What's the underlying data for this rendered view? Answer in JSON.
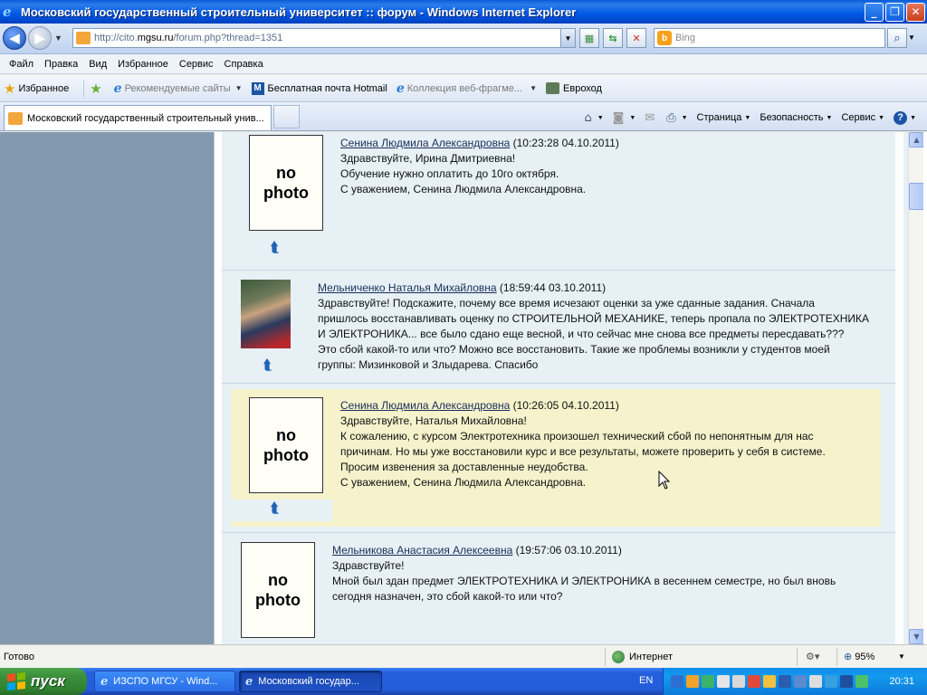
{
  "window": {
    "title": "Московский государственный строительный университет :: форум - Windows Internet Explorer",
    "buttons": {
      "minimize": "_",
      "maximize": "❐",
      "close": "✕"
    }
  },
  "address": {
    "url_prefix": "http://cito.",
    "url_domain": "mgsu.ru",
    "url_suffix": "/forum.php?thread=1351",
    "search_placeholder": "Bing"
  },
  "menu": [
    "Файл",
    "Правка",
    "Вид",
    "Избранное",
    "Сервис",
    "Справка"
  ],
  "favorites": {
    "favorites_label": "Избранное",
    "recommended": "Рекомендуемые сайты",
    "hotmail": "Бесплатная почта Hotmail",
    "webslice": "Коллекция веб-фрагме...",
    "euro": "Евроход"
  },
  "tab": {
    "label": "Московский государственный строительный унив..."
  },
  "commands": {
    "page": "Страница",
    "safety": "Безопасность",
    "tools": "Сервис"
  },
  "posts": [
    {
      "author": "Сенина Людмила Александровна",
      "time": "(10:23:28 04.10.2011)",
      "avatar": "no photo",
      "lines": [
        "Здравствуйте, Ирина Дмитриевна!",
        "Обучение нужно оплатить до 10го октября.",
        "С уважением, Сенина Людмила Александровна."
      ]
    },
    {
      "author": "Мельниченко Наталья Михайловна",
      "time": "(18:59:44 03.10.2011)",
      "avatar": "photo",
      "lines": [
        "Здравствуйте! Подскажите, почему все время исчезают оценки за уже сданные задания. Сначала",
        "пришлось восстанавливать оценку по СТРОИТЕЛЬНОЙ МЕХАНИКЕ, теперь пропала по ЭЛЕКТРОТЕХНИКА",
        "И ЭЛЕКТРОНИКА... все было сдано еще весной, и что сейчас мне снова все предметы пересдавать???",
        "Это сбой какой-то или что? Можно все восстановить. Такие же проблемы возникли у студентов моей",
        "группы: Мизинковой и Злыдарева. Спасибо"
      ]
    },
    {
      "author": "Сенина Людмила Александровна",
      "time": "(10:26:05 04.10.2011)",
      "avatar": "no photo",
      "lines": [
        "Здравствуйте, Наталья Михайловна!",
        "К сожалению, с курсом Электротехника произошел технический сбой по непонятным для нас",
        "причинам. Но мы уже восстановили курс и все результаты, можете проверить у себя в системе.",
        "Просим извенения за доставленные неудобства.",
        "С уважением, Сенина Людмила Александровна."
      ]
    },
    {
      "author": "Мельникова Анастасия Алексеевна",
      "time": "(19:57:06 03.10.2011)",
      "avatar": "no photo",
      "lines": [
        "Здравствуйте!",
        "Мной был здан предмет ЭЛЕКТРОТЕХНИКА И ЭЛЕКТРОНИКА в весеннем семестре, но был вновь",
        "сегодня назначен, это сбой какой-то или что?"
      ]
    }
  ],
  "nophoto": {
    "line1": "no",
    "line2": "photo"
  },
  "status": {
    "text": "Готово",
    "zone": "Интернет",
    "zoom": "95%"
  },
  "taskbar": {
    "start": "пуск",
    "buttons": [
      "ИЗСПО МГСУ - Wind...",
      "Московский государ..."
    ],
    "lang": "EN",
    "clock": "20:31"
  },
  "colors": {
    "highlight_post_bg": "#F5F2CC",
    "post_bg": "#E6F0F5",
    "left_column": "#8399AE"
  }
}
